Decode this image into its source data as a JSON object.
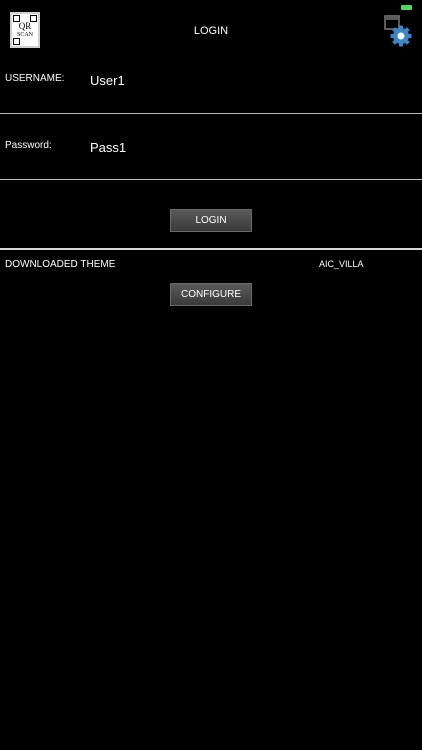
{
  "header": {
    "title": "LOGIN",
    "qr_top": "QR",
    "qr_bottom": "SCAN"
  },
  "form": {
    "username_label": "USERNAME:",
    "username_value": "User1",
    "password_label": "Password:",
    "password_value": "Pass1",
    "login_button": "LOGIN"
  },
  "theme": {
    "label": "DOWNLOADED THEME",
    "value": "AIC_VILLA",
    "configure_button": "CONFIGURE"
  },
  "colors": {
    "background": "#000000",
    "text": "#ffffff",
    "divider": "#bdbdbd",
    "battery": "#4cd964",
    "gear": "#3a86c8"
  },
  "icons": {
    "qr": "qr-scan-icon",
    "settings": "gear-settings-icon"
  }
}
